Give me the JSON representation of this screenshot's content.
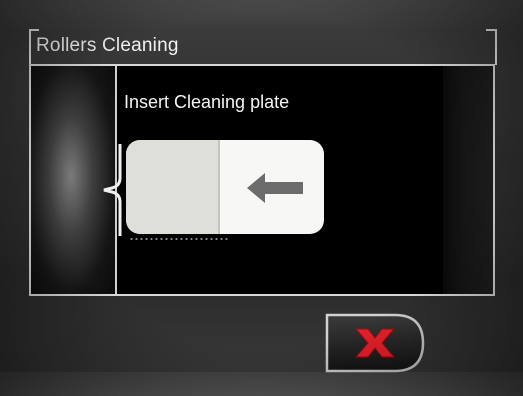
{
  "dialog": {
    "title": "Rollers Cleaning",
    "instruction": "Insert Cleaning plate"
  },
  "icons": {
    "insert_direction": "arrow-left-icon",
    "cancel": "close-icon"
  },
  "colors": {
    "cancel_icon": "#e8202a",
    "screen_bg": "#2a2a2a",
    "panel_bg": "#000000"
  }
}
